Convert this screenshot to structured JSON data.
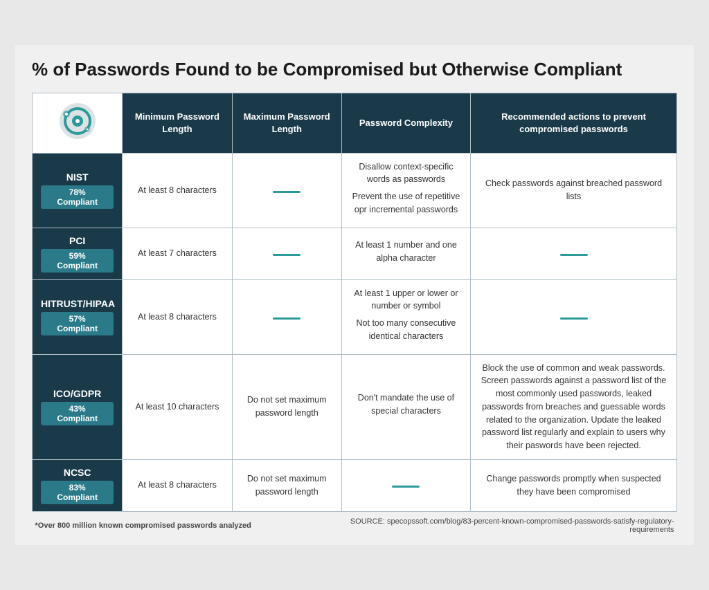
{
  "title": "% of Passwords Found to be Compromised but Otherwise Compliant",
  "columns": {
    "label": "",
    "min_length": "Minimum Password Length",
    "max_length": "Maximum Password Length",
    "complexity": "Password Complexity",
    "recommended": "Recommended actions to prevent compromised passwords"
  },
  "rows": [
    {
      "standard": "NIST",
      "compliance": "78% Compliant",
      "min_length": "At least 8 characters",
      "max_length": null,
      "complexity": "Disallow context-specific words as passwords\n\nPrevent the use of repetitive opr incremental passwords",
      "recommended": "Check passwords against breached password lists"
    },
    {
      "standard": "PCI",
      "compliance": "59% Compliant",
      "min_length": "At least 7 characters",
      "max_length": null,
      "complexity": "At least 1 number and one alpha character",
      "recommended": null
    },
    {
      "standard": "HITRUST/HIPAA",
      "compliance": "57% Compliant",
      "min_length": "At least 8 characters",
      "max_length": null,
      "complexity": "At least 1 upper or lower or number or symbol\n\nNot too many consecutive identical characters",
      "recommended": null
    },
    {
      "standard": "ICO/GDPR",
      "compliance": "43% Compliant",
      "min_length": "At least 10 characters",
      "max_length": "Do not set maximum password length",
      "complexity": "Don't mandate the use of special characters",
      "recommended": "Block the use of common and weak passwords. Screen passwords against a password list of the most commonly used passwords, leaked passwords from breaches and guessable words related to the organization. Update the leaked password list regularly and explain to users why their paswords have been rejected."
    },
    {
      "standard": "NCSC",
      "compliance": "83% Compliant",
      "min_length": "At least 8 characters",
      "max_length": "Do not set maximum password length",
      "complexity": null,
      "recommended": "Change passwords promptly when suspected they have been compromised"
    }
  ],
  "footer": {
    "left": "*Over 800 million known compromised passwords analyzed",
    "right": "SOURCE: specopssoft.com/blog/83-percent-known-compromised-passwords-satisfy-regulatory-requirements"
  }
}
